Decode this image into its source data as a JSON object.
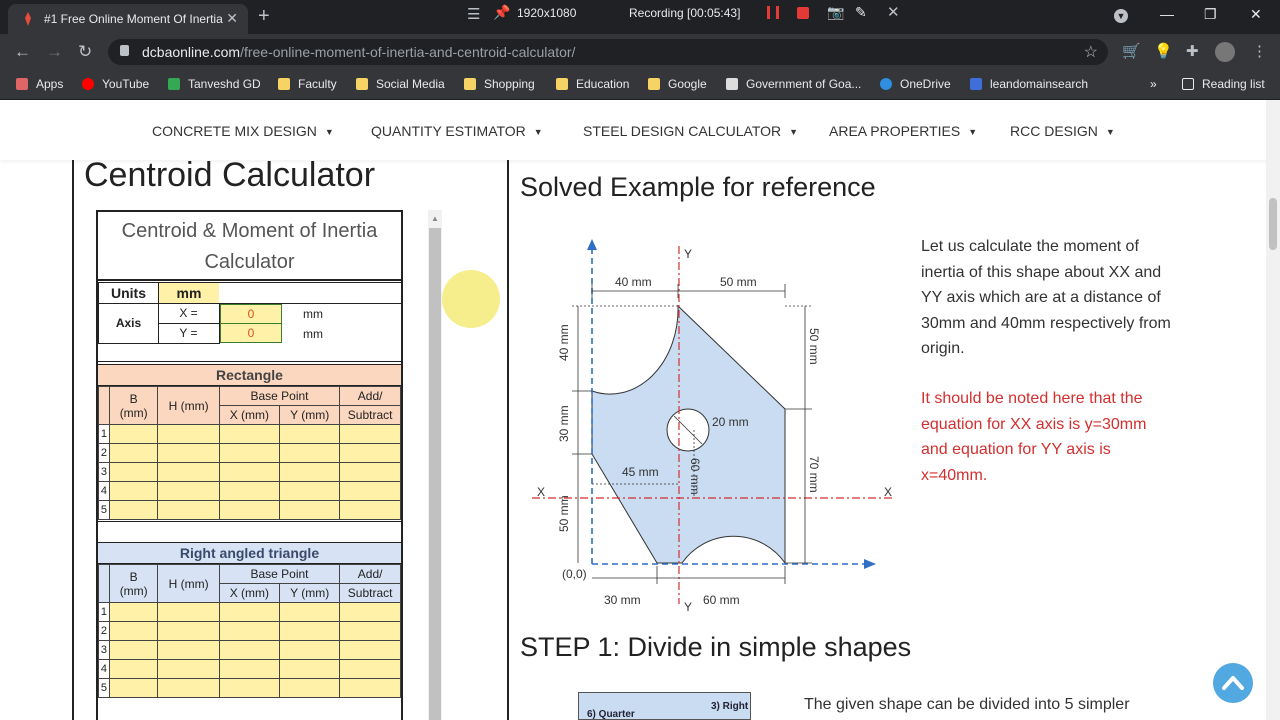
{
  "browser": {
    "tab_title": "#1 Free Online Moment Of Inertia",
    "tab_close": "✕",
    "new_tab": "+",
    "url_domain": "dcbaonline.com",
    "url_path": "/free-online-moment-of-inertia-and-centroid-calculator/",
    "recorder": {
      "resolution": "1920x1080",
      "status": "Recording [00:05:43]"
    },
    "bookmarks": [
      "Apps",
      "YouTube",
      "Tanveshd GD",
      "Faculty",
      "Social Media",
      "Shopping",
      "Education",
      "Google",
      "Government of Goa...",
      "OneDrive",
      "leandomainsearch"
    ],
    "reading_list": "Reading list",
    "overflow": "»"
  },
  "site_nav": [
    {
      "label": "CONCRETE MIX DESIGN",
      "caret": "▼"
    },
    {
      "label": "QUANTITY ESTIMATOR",
      "caret": "▼"
    },
    {
      "label": "STEEL DESIGN CALCULATOR",
      "caret": "▼"
    },
    {
      "label": "AREA PROPERTIES",
      "caret": "▼"
    },
    {
      "label": "RCC DESIGN",
      "caret": "▼"
    }
  ],
  "calculator": {
    "page_title": "Centroid Calculator",
    "sheet_title_1": "Centroid & Moment of Inertia",
    "sheet_title_2": "Calculator",
    "units_label": "Units",
    "units_value": "mm",
    "axis_label": "Axis",
    "x_label": "X =",
    "y_label": "Y =",
    "x_value": "0",
    "y_value": "0",
    "x_unit": "mm",
    "y_unit": "mm",
    "rectangle": {
      "title": "Rectangle",
      "col_b": "B",
      "col_b_unit": "(mm)",
      "col_h": "H (mm)",
      "col_base": "Base Point",
      "col_x": "X (mm)",
      "col_y": "Y (mm)",
      "col_add": "Add/",
      "col_sub": "Subtract",
      "rows": [
        "1",
        "2",
        "3",
        "4",
        "5"
      ]
    },
    "triangle": {
      "title": "Right angled triangle",
      "col_b": "B",
      "col_b_unit": "(mm)",
      "col_h": "H (mm)",
      "col_base": "Base Point",
      "col_x": "X (mm)",
      "col_y": "Y (mm)",
      "col_add": "Add/",
      "col_sub": "Subtract",
      "rows": [
        "1",
        "2",
        "3",
        "4",
        "5"
      ]
    }
  },
  "example": {
    "title": "Solved Example for reference",
    "paragraph_1": "Let us calculate the moment of inertia of this shape about XX and YY axis which are at a distance of 30mm and 40mm respectively from origin.",
    "paragraph_2": "It should be noted here that the equation for XX axis is y=30mm and equation for YY axis is x=40mm.",
    "figure": {
      "dim_40_top": "40 mm",
      "dim_50_top": "50 mm",
      "dim_40_left": "40 mm",
      "dim_30_left": "30 mm",
      "dim_50_left": "50 mm",
      "dim_50_right": "50 mm",
      "dim_70_right": "70 mm",
      "dim_20": "20 mm",
      "dim_45": "45 mm",
      "dim_60_v": "60 mm",
      "dim_30_bottom": "30 mm",
      "dim_60_bottom": "60 mm",
      "origin": "(0,0)",
      "x_left": "X",
      "x_right": "X",
      "y_top": "Y",
      "y_bottom": "Y"
    },
    "step1_title": "STEP 1: Divide in simple shapes",
    "step1_text": "The given shape can be divided into 5 simpler",
    "thumb_a": "6) Quarter",
    "thumb_b": "3) Right"
  }
}
